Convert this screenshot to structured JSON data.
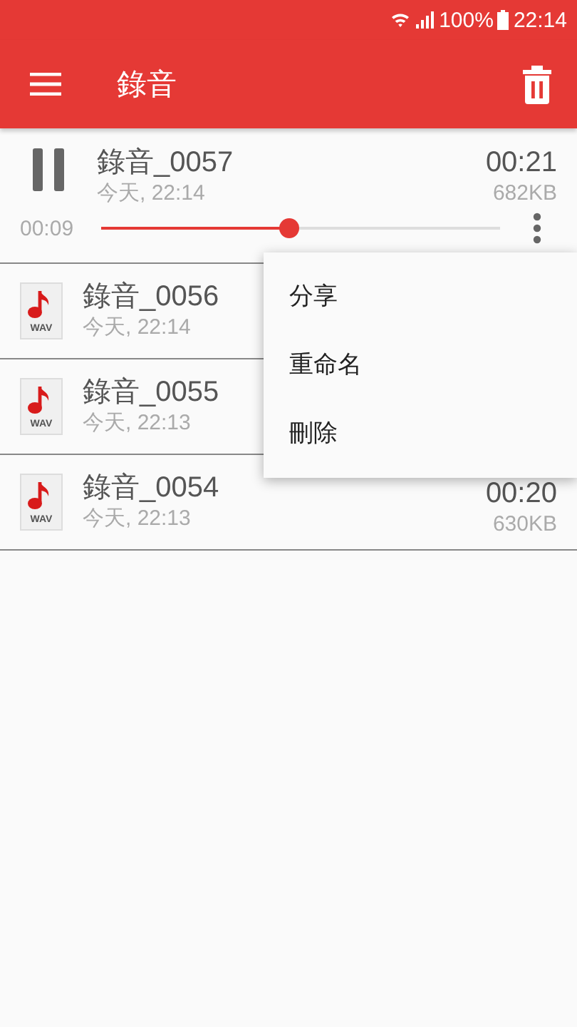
{
  "status_bar": {
    "battery": "100%",
    "time": "22:14"
  },
  "app_bar": {
    "title": "錄音"
  },
  "recordings": [
    {
      "kind": "playing",
      "name": "錄音_0057",
      "date": "今天, 22:14",
      "duration": "00:21",
      "size": "682KB",
      "elapsed": "00:09",
      "level": 0.47
    },
    {
      "kind": "file",
      "badge": "WAV",
      "name": "錄音_0056",
      "date": "今天, 22:14"
    },
    {
      "kind": "file",
      "badge": "WAV",
      "name": "錄音_0055",
      "date": "今天, 22:13"
    },
    {
      "kind": "file",
      "badge": "WAV",
      "name": "錄音_0054",
      "date": "今天, 22:13",
      "duration": "00:20",
      "size": "630KB"
    }
  ],
  "menu": {
    "items": [
      "分享",
      "重命名",
      "刪除"
    ]
  }
}
